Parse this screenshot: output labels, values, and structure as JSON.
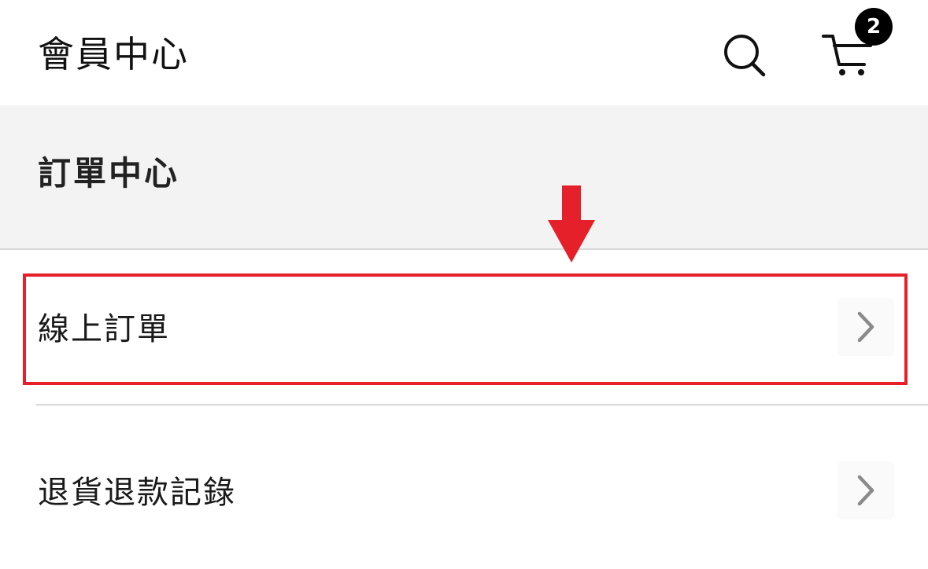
{
  "header": {
    "title": "會員中心",
    "search_icon": "search-icon",
    "cart_icon": "cart-icon",
    "cart_count": "2"
  },
  "section": {
    "title": "訂單中心"
  },
  "menu": {
    "items": [
      {
        "label": "線上訂單",
        "icon": "chevron-right-icon",
        "highlighted": true
      },
      {
        "label": "退貨退款記錄",
        "icon": "chevron-right-icon",
        "highlighted": false
      }
    ]
  },
  "annotation": {
    "highlight_color": "#e5202a",
    "arrow_icon": "arrow-down-icon"
  },
  "colors": {
    "section_bg": "#f3f3f3",
    "divider": "#d8d8d8",
    "badge_bg": "#000000",
    "chevron": "#8a8a8a"
  }
}
